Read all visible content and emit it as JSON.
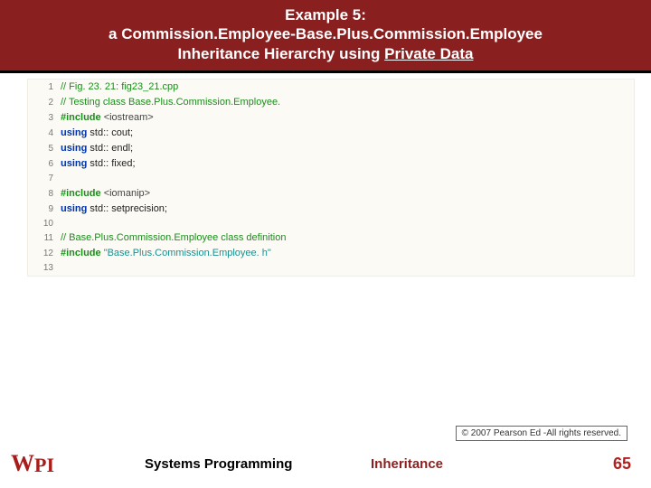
{
  "header": {
    "line1": "Example 5:",
    "line2_a": "a Commission.Employee-Base.Plus.Commission.Employee",
    "line3_a": "Inheritance Hierarchy using ",
    "line3_u": "Private Data"
  },
  "code": [
    {
      "n": "1",
      "segs": [
        {
          "cls": "c-comment",
          "t": "// Fig. 23. 21: fig23_21.cpp"
        }
      ]
    },
    {
      "n": "2",
      "segs": [
        {
          "cls": "c-comment",
          "t": "// Testing class Base.Plus.Commission.Employee."
        }
      ]
    },
    {
      "n": "3",
      "segs": [
        {
          "cls": "c-pp",
          "t": "#include "
        },
        {
          "cls": "c-inc",
          "t": "<iostream>"
        }
      ]
    },
    {
      "n": "4",
      "segs": [
        {
          "cls": "c-kw",
          "t": "using "
        },
        {
          "cls": "c-plain",
          "t": "std:: cout;"
        }
      ]
    },
    {
      "n": "5",
      "segs": [
        {
          "cls": "c-kw",
          "t": "using "
        },
        {
          "cls": "c-plain",
          "t": "std:: endl;"
        }
      ]
    },
    {
      "n": "6",
      "segs": [
        {
          "cls": "c-kw",
          "t": "using "
        },
        {
          "cls": "c-plain",
          "t": "std:: fixed;"
        }
      ]
    },
    {
      "n": "7",
      "segs": []
    },
    {
      "n": "8",
      "segs": [
        {
          "cls": "c-pp",
          "t": "#include "
        },
        {
          "cls": "c-inc",
          "t": "<iomanip>"
        }
      ]
    },
    {
      "n": "9",
      "segs": [
        {
          "cls": "c-kw",
          "t": "using "
        },
        {
          "cls": "c-plain",
          "t": "std:: setprecision;"
        }
      ]
    },
    {
      "n": "10",
      "segs": []
    },
    {
      "n": "11",
      "segs": [
        {
          "cls": "c-comment",
          "t": "// Base.Plus.Commission.Employee class definition"
        }
      ]
    },
    {
      "n": "12",
      "segs": [
        {
          "cls": "c-pp",
          "t": "#include "
        },
        {
          "cls": "c-str",
          "t": "\"Base.Plus.Commission.Employee. h\""
        }
      ]
    },
    {
      "n": "13",
      "segs": []
    }
  ],
  "copyright": "© 2007 Pearson Ed -All rights reserved.",
  "footer": {
    "logo_w": "W",
    "logo_p": "P",
    "logo_i": "I",
    "left": "Systems Programming",
    "right": "Inheritance",
    "page": "65"
  }
}
